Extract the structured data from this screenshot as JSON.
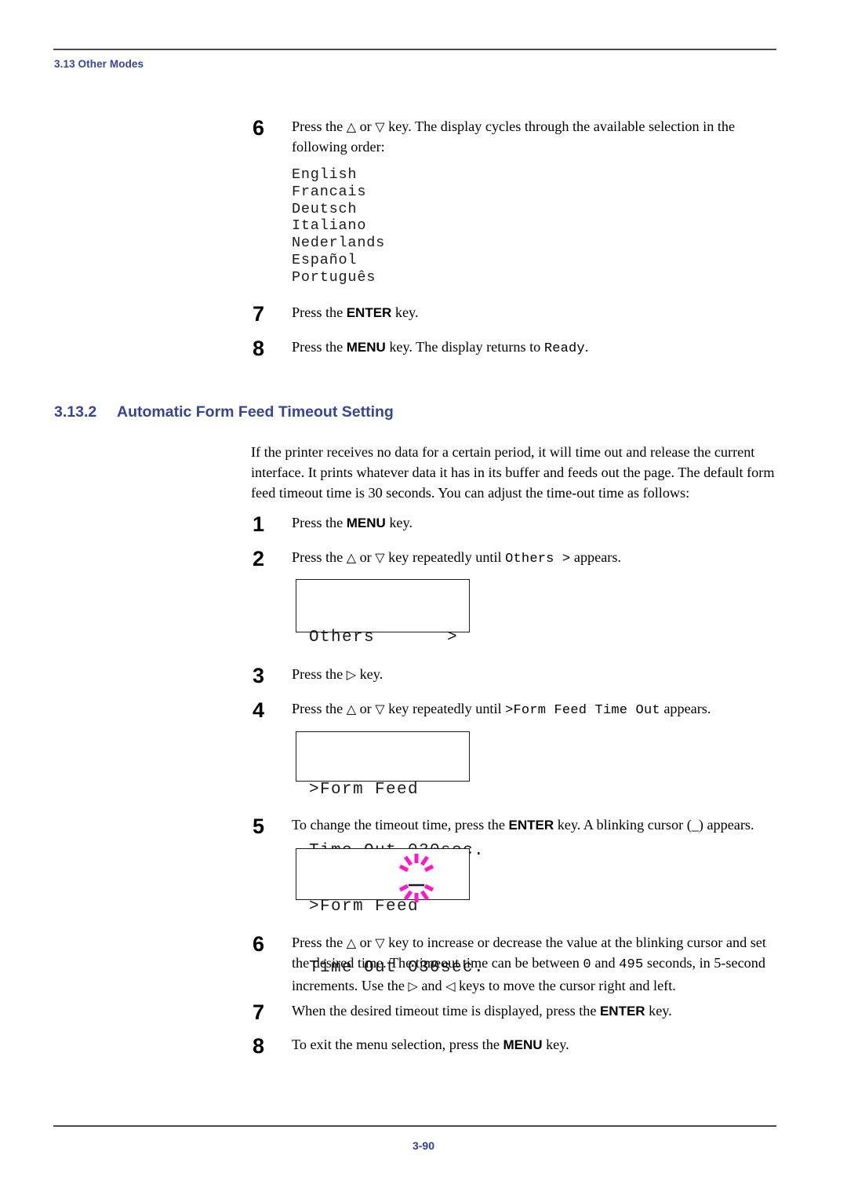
{
  "header": {
    "section_label": "3.13 Other Modes"
  },
  "footer": {
    "page_number": "3-90"
  },
  "heading": {
    "number": "3.13.2",
    "title": "Automatic Form Feed Timeout Setting"
  },
  "steps_top": [
    {
      "num": "6",
      "line1_a": "Press the ",
      "tri_up": "△",
      "line1_b": " or ",
      "tri_down": "▽",
      "line1_c": " key. The display cycles through the available selection in the",
      "line2": "following order:"
    },
    {
      "num": "7",
      "pre": "Press the ",
      "key": "ENTER",
      "post": " key."
    },
    {
      "num": "8",
      "pre": "Press the ",
      "key": "MENU",
      "mid": " key. The display returns to ",
      "mono": "Ready",
      "post": "."
    }
  ],
  "language_list": [
    "English",
    "Francais",
    "Deutsch",
    "Italiano",
    "Nederlands",
    "Español",
    "Português"
  ],
  "intro_paragraph": {
    "line1": "If the printer receives no data for a certain period, it will time out and release the current",
    "line2": "interface. It prints whatever data it has in its buffer and feeds out the page. The default form",
    "line3": "feed timeout time is 30 seconds. You can adjust the time-out time as follows:"
  },
  "steps_bottom": [
    {
      "num": "1",
      "pre": "Press the ",
      "key": "MENU",
      "post": " key."
    },
    {
      "num": "2",
      "pre": "Press the ",
      "tri_up": "△",
      "mid1": " or ",
      "tri_down": "▽",
      "mid2": " key repeatedly until ",
      "mono": "Others  >",
      "post": " appears."
    },
    {
      "num": "3",
      "pre": "Press the ",
      "tri_right": "▷",
      "post": " key."
    },
    {
      "num": "4",
      "pre": "Press the ",
      "tri_up": "△",
      "mid1": " or ",
      "tri_down": "▽",
      "mid2": " key repeatedly until ",
      "mono": ">Form Feed Time Out",
      "post": " appears."
    },
    {
      "num": "5",
      "pre": "To change the timeout time, press the ",
      "key": "ENTER",
      "post": " key. A blinking cursor (_) appears."
    },
    {
      "num": "6",
      "l1_pre": "Press the ",
      "tri_up": "△",
      "l1_mid": " or ",
      "tri_down": "▽",
      "l1_post": " key to increase or decrease the value at the blinking cursor and set",
      "l2_pre": "the desired time. The timeout time can be between ",
      "l2_mono1": "0",
      "l2_mid": " and ",
      "l2_mono2": "495",
      "l2_post": " seconds, in 5-second",
      "l3_pre": "increments. Use the ",
      "tri_right": "▷",
      "l3_mid": " and ",
      "tri_left": "◁",
      "l3_post": " keys to move the cursor right and left."
    },
    {
      "num": "7",
      "pre": "When the desired timeout time is displayed, press the ",
      "key": "ENTER",
      "post": " key."
    },
    {
      "num": "8",
      "pre": " To exit the menu selection, press the ",
      "key": "MENU",
      "post": " key."
    }
  ],
  "lcd_panels": [
    {
      "id": "others",
      "line1_left": "Others",
      "line1_right": ">",
      "line2": ""
    },
    {
      "id": "form-feed",
      "line1": ">Form Feed",
      "line2": "Time Out 030sec."
    },
    {
      "id": "form-feed-cursor",
      "line1": ">Form Feed",
      "line2": "Time Out 030sec.",
      "cursor_color": "#FF17CC"
    }
  ],
  "colors": {
    "heading_blue": "#36459a",
    "page_number_blue": "#2b3f9e",
    "rule_gray": "#4a4a4a",
    "cursor_magenta": "#FF17CC",
    "text_black": "#000000"
  }
}
